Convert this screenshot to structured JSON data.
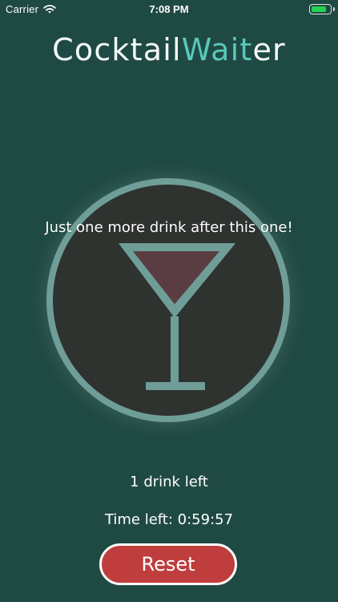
{
  "status_bar": {
    "carrier": "Carrier",
    "time": "7:08 PM",
    "icons": {
      "wifi": "wifi-icon",
      "battery": "battery-icon"
    }
  },
  "app": {
    "title_prefix": "Cocktail",
    "title_accent": "Wait",
    "title_suffix": "er",
    "message": "Just one more drink after this one!",
    "drinks_left": "1 drink left",
    "time_left": "Time left: 0:59:57",
    "reset_label": "Reset"
  },
  "colors": {
    "background": "#1f4a43",
    "accent": "#59c8bb",
    "glass_ring": "#6f9e99",
    "glass_inner": "#2f332f",
    "drink": "#5a3d42",
    "reset_button": "#bf3d3d"
  },
  "icons": {
    "cocktail": "martini-glass-icon"
  }
}
